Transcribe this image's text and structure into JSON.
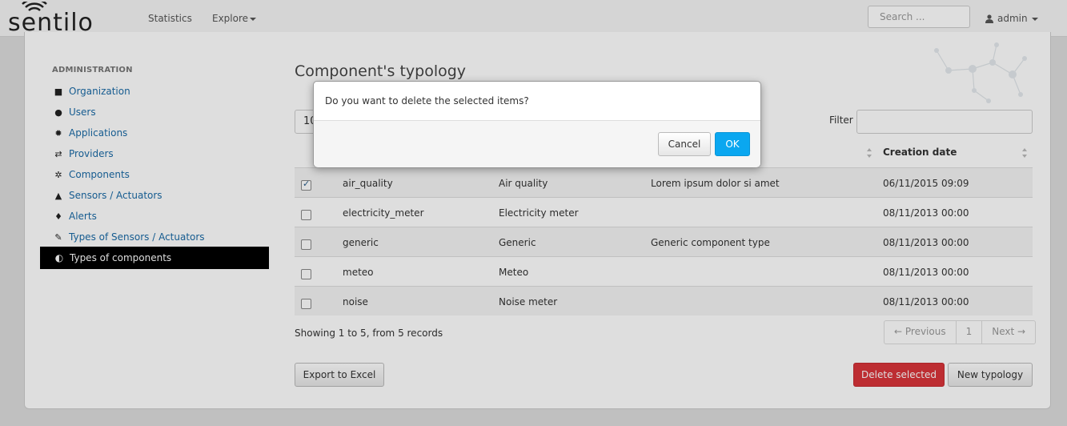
{
  "navbar": {
    "logo_text": "sentilo",
    "links": [
      {
        "label": "Statistics"
      },
      {
        "label": "Explore"
      }
    ],
    "search_placeholder": "Search ...",
    "user_label": "admin"
  },
  "sidebar": {
    "title": "ADMINISTRATION",
    "items": [
      {
        "label": "Organization",
        "icon": "briefcase-icon"
      },
      {
        "label": "Users",
        "icon": "user-icon"
      },
      {
        "label": "Applications",
        "icon": "gear-icon"
      },
      {
        "label": "Providers",
        "icon": "exchange-icon"
      },
      {
        "label": "Components",
        "icon": "gears-icon"
      },
      {
        "label": "Sensors / Actuators",
        "icon": "flask-icon"
      },
      {
        "label": "Alerts",
        "icon": "bell-icon"
      },
      {
        "label": "Types of Sensors / Actuators",
        "icon": "wrench-icon"
      },
      {
        "label": "Types of components",
        "icon": "half-circle-icon",
        "active": true
      }
    ]
  },
  "main": {
    "title": "Component's typology",
    "length_value": "10",
    "filter_label": "Filter",
    "columns": [
      "",
      "",
      "",
      "Creation date"
    ],
    "rows": [
      {
        "checked": true,
        "id": "air_quality",
        "name": "Air quality",
        "description": "Lorem ipsum dolor si amet",
        "date": "06/11/2015 09:09"
      },
      {
        "checked": false,
        "id": "electricity_meter",
        "name": "Electricity meter",
        "description": "",
        "date": "08/11/2013 00:00"
      },
      {
        "checked": false,
        "id": "generic",
        "name": "Generic",
        "description": "Generic component type",
        "date": "08/11/2013 00:00"
      },
      {
        "checked": false,
        "id": "meteo",
        "name": "Meteo",
        "description": "",
        "date": "08/11/2013 00:00"
      },
      {
        "checked": false,
        "id": "noise",
        "name": "Noise meter",
        "description": "",
        "date": "08/11/2013 00:00"
      }
    ],
    "info": "Showing 1 to 5, from 5 records",
    "pager": {
      "previous": "← Previous",
      "page": "1",
      "next": "Next →"
    },
    "export_label": "Export to Excel",
    "delete_label": "Delete selected",
    "new_label": "New typology"
  },
  "modal": {
    "message": "Do you want to delete the selected items?",
    "cancel_label": "Cancel",
    "ok_label": "OK"
  },
  "colors": {
    "link": "#1a6aa6",
    "danger": "#d9343a",
    "primary": "#0aa7f0",
    "active_bg": "#000000"
  }
}
